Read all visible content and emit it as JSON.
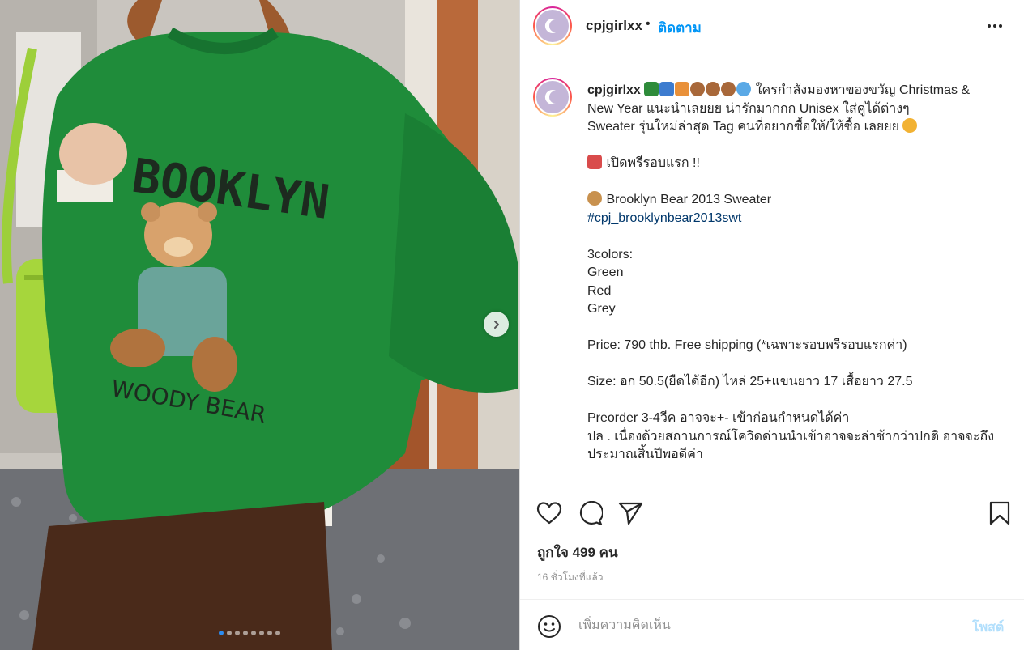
{
  "post": {
    "username": "cpjgirlxx",
    "separator": "•",
    "follow_label": "ติดตาม",
    "more_icon": "more-horizontal-icon",
    "caption": {
      "username": "cpjgirlxx",
      "line1": "ใครกำลังมองหาของขวัญ Christmas &",
      "line2": "New Year แนะนำเลยยย น่ารักมากกก Unisex ใส่คู่ได้ต่างๆ",
      "line3": "Sweater รุ่นใหม่ล่าสุด Tag คนที่อยากซื้อให้/ให้ซื้อ เลยยย",
      "preorder_open": "เปิดพรีรอบแรก !!",
      "product_name": "Brooklyn Bear 2013 Sweater",
      "hashtag": "#cpj_brooklynbear2013swt",
      "colors_title": "3colors:",
      "colors": [
        "Green",
        "Red",
        "Grey"
      ],
      "price": "Price: 790 thb. Free shipping (*เฉพาะรอบพรีรอบแรกค่า)",
      "size": "Size: อก 50.5(ยืดได้อีก) ไหล่ 25+แขนยาว 17 เสื้อยาว 27.5",
      "preorder_line1": "Preorder 3-4วีค อาจจะ+- เข้าก่อนกำหนดได้ค่า",
      "preorder_line2": "ปล . เนื่องด้วยสถานการณ์โควิดด่านนำเข้าอาจจะล่าช้ากว่าปกติ อาจจะถึง",
      "preorder_line3": "ประมาณสิ้นปีพอดีค่า"
    },
    "likes_text": "ถูกใจ 499 คน",
    "time_text": "16 ชั่วโมงที่แล้ว",
    "comment": {
      "placeholder": "เพิ่มความคิดเห็น",
      "post_label": "โพสต์"
    },
    "carousel": {
      "slide_count": 8,
      "active_index": 0
    },
    "icons": {
      "like": "heart-icon",
      "comment": "comment-icon",
      "share": "send-icon",
      "save": "bookmark-icon",
      "emoji": "emoji-icon",
      "next": "chevron-right-icon"
    },
    "colors": {
      "accent": "#0095f6",
      "hashtag": "#00376b",
      "muted": "#8e8e8e",
      "post_disabled": "#b2dffc"
    }
  }
}
